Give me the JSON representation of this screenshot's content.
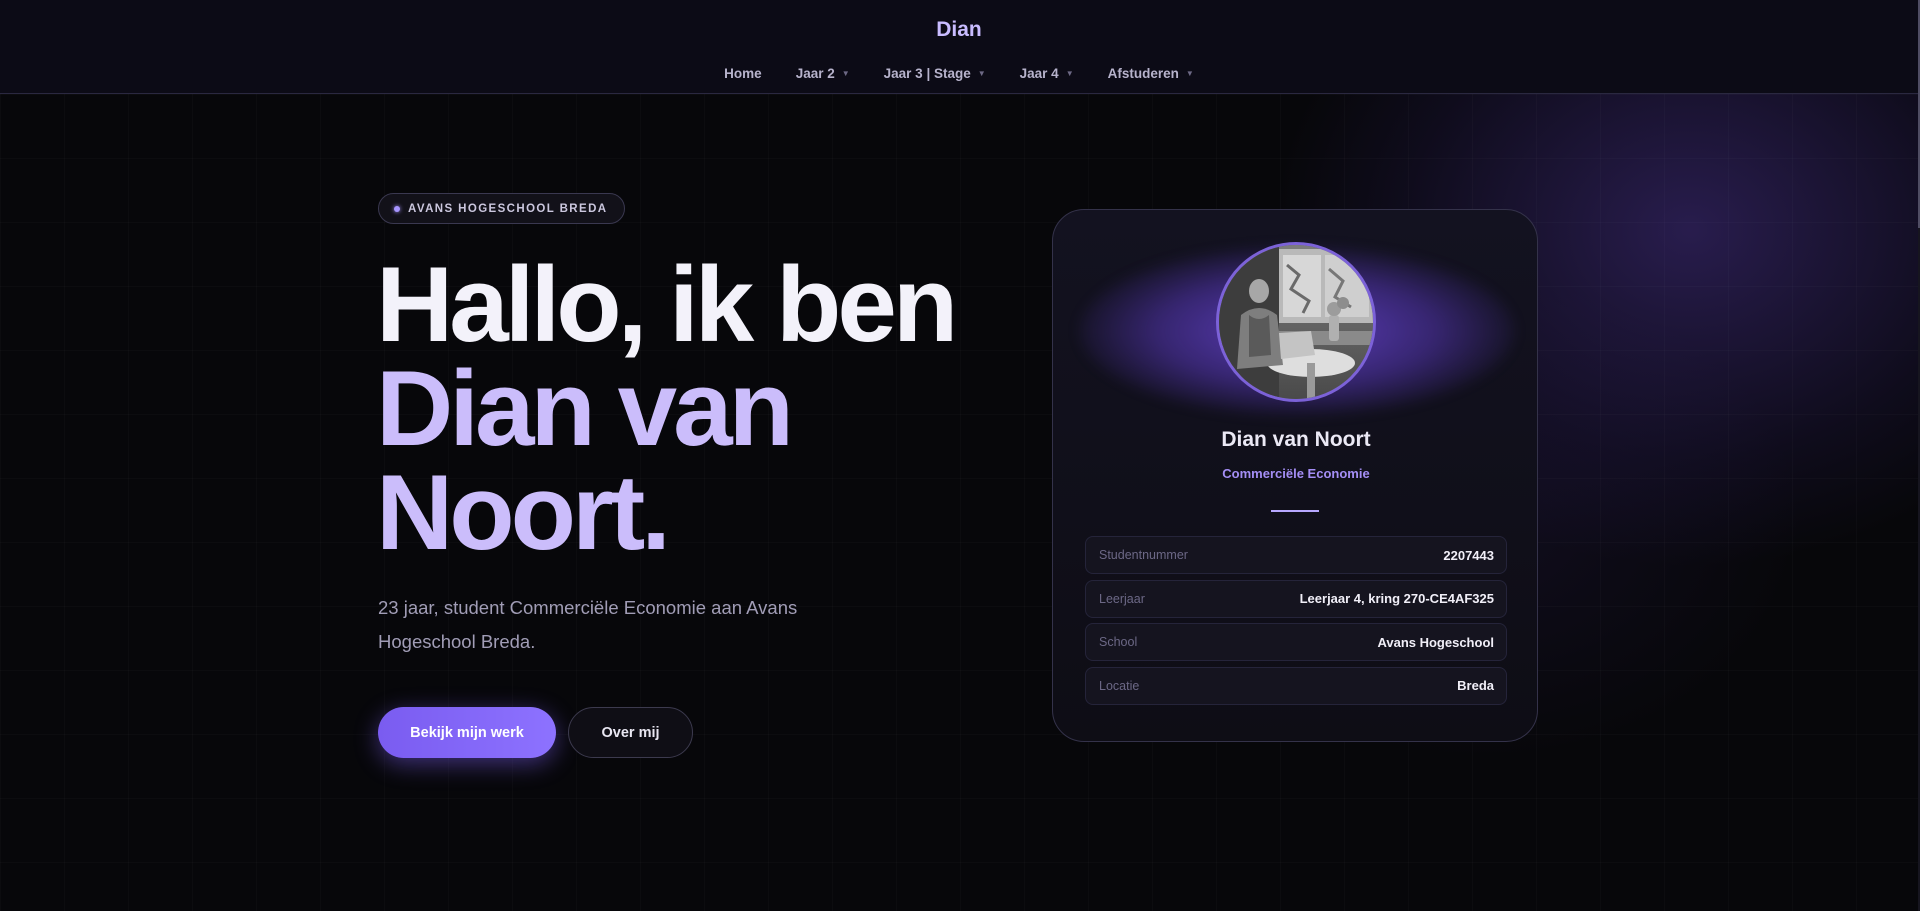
{
  "header": {
    "brand": "Dian",
    "nav": [
      {
        "label": "Home",
        "has_dropdown": false
      },
      {
        "label": "Jaar 2",
        "has_dropdown": true
      },
      {
        "label": "Jaar 3 | Stage",
        "has_dropdown": true
      },
      {
        "label": "Jaar 4",
        "has_dropdown": true
      },
      {
        "label": "Afstuderen",
        "has_dropdown": true
      }
    ],
    "caret_icon": "▼"
  },
  "hero": {
    "badge": "AVANS HOGESCHOOL BREDA",
    "headline_line1": "Hallo, ik ben",
    "headline_line2": "Dian van",
    "headline_line3": "Noort.",
    "intro": "23 jaar, student Commerciële Economie aan Avans Hogeschool Breda.",
    "primary_button": "Bekijk mijn werk",
    "secondary_button": "Over mij"
  },
  "card": {
    "name": "Dian van Noort",
    "role": "Commerciële Economie",
    "info": [
      {
        "label": "Studentnummer",
        "value": "2207443"
      },
      {
        "label": "Leerjaar",
        "value": "Leerjaar 4, kring 270-CE4AF325"
      },
      {
        "label": "School",
        "value": "Avans Hogeschool"
      },
      {
        "label": "Locatie",
        "value": "Breda"
      }
    ]
  },
  "colors": {
    "accent": "#8d72ff",
    "accent_light": "#cbbdfb",
    "background": "#07070a"
  }
}
